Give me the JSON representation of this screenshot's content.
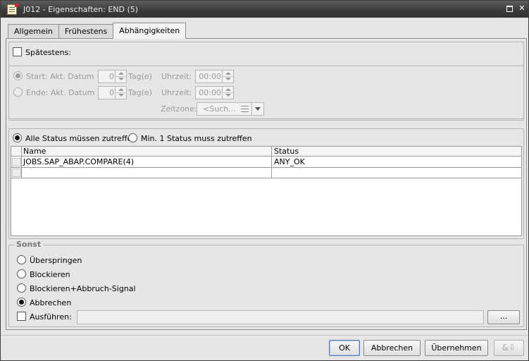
{
  "window": {
    "title": "J012 - Eigenschaften: END (5)"
  },
  "tabs": [
    {
      "label": "Allgemein"
    },
    {
      "label": "Frühestens"
    },
    {
      "label": "Abhängigkeiten"
    }
  ],
  "latest": {
    "label": "Spätestens:",
    "checked": false,
    "start": {
      "label": "Start: Akt. Datum +",
      "days": "0",
      "days_unit": "Tag(e)",
      "time_label": "Uhrzeit:",
      "time": "00:00"
    },
    "end": {
      "label": "Ende: Akt. Datum +",
      "days": "0",
      "days_unit": "Tag(e)",
      "time_label": "Uhrzeit:",
      "time": "00:00"
    },
    "timezone": {
      "label": "Zeitzone:",
      "placeholder": "<Such..."
    }
  },
  "status_mode": {
    "all": "Alle Status müssen zutreffen",
    "min_one": "Min. 1 Status muss zutreffen",
    "selected": "all"
  },
  "dependency_table": {
    "columns": [
      "Name",
      "Status"
    ],
    "rows": [
      {
        "name": "JOBS.SAP_ABAP.COMPARE(4)",
        "status": "ANY_OK"
      },
      {
        "name": "",
        "status": ""
      }
    ]
  },
  "sonst": {
    "legend": "Sonst",
    "options": [
      {
        "label": "Überspringen",
        "checked": false
      },
      {
        "label": "Blockieren",
        "checked": false
      },
      {
        "label": "Blockieren+Abbruch-Signal",
        "checked": false
      },
      {
        "label": "Abbrechen",
        "checked": true
      }
    ],
    "execute_label": "Ausführen:",
    "execute_value": "",
    "browse_label": "..."
  },
  "buttons": {
    "ok": "OK",
    "cancel": "Abbrechen",
    "apply": "Übernehmen"
  },
  "icons": {
    "window": "property-sheet-icon",
    "restore": "restore-icon",
    "close": "close-icon",
    "help": "variables-icon"
  }
}
